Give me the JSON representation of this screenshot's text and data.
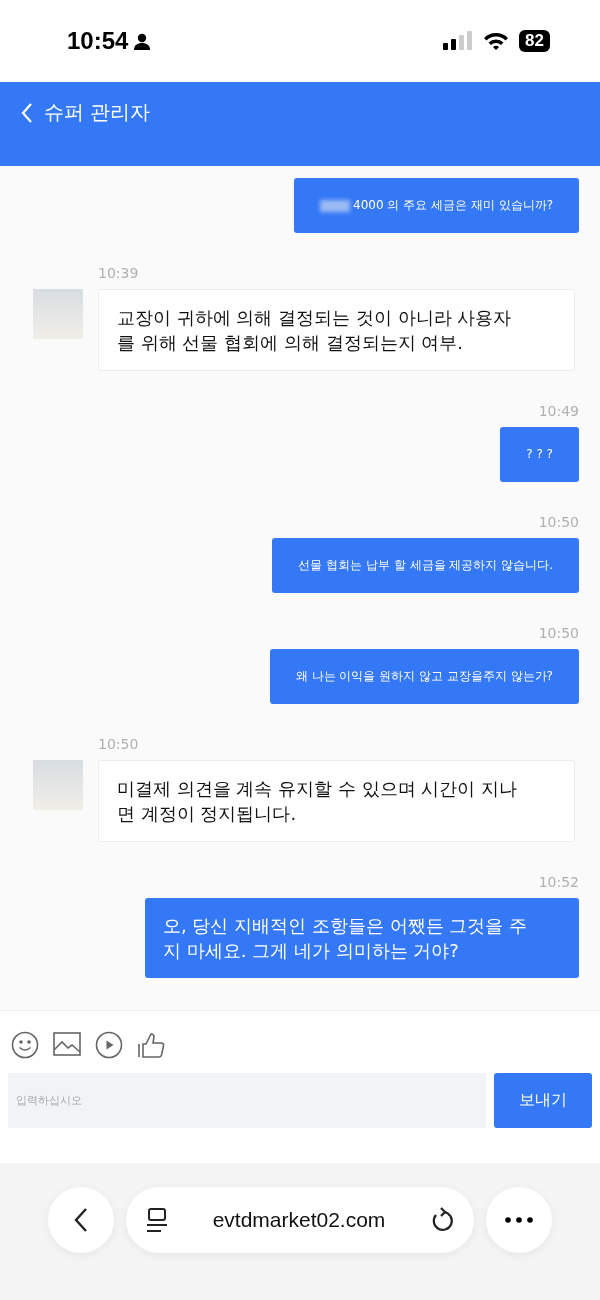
{
  "status_bar": {
    "time": "10:54",
    "battery": "82"
  },
  "header": {
    "title": "슈퍼 관리자"
  },
  "messages": [
    {
      "kind": "outgoing",
      "redacted": true,
      "text": "4000 의 주요 세금은 재미 있습니까?"
    },
    {
      "kind": "incoming",
      "time": "10:39",
      "text": "교장이 귀하에 의해 결정되는 것이 아니라 사용자를 위해 선물 협회에 의해 결정되는지 여부."
    },
    {
      "kind": "outgoing",
      "time": "10:49",
      "text": "? ? ?"
    },
    {
      "kind": "outgoing",
      "time": "10:50",
      "text": "선물 협회는 납부 할 세금을 제공하지 않습니다."
    },
    {
      "kind": "outgoing",
      "time": "10:50",
      "text": "왜 나는 이익을 원하지 않고 교장을주지 않는가?"
    },
    {
      "kind": "incoming",
      "time": "10:50",
      "text": "미결제 의견을 계속 유지할 수 있으며 시간이 지나면 계정이 정지됩니다."
    },
    {
      "kind": "outgoing-large",
      "time": "10:52",
      "text": "오, 당신 지배적인 조항들은 어쨌든 그것을 주지 마세요. 그게 네가 의미하는 거야?"
    }
  ],
  "composer": {
    "placeholder": "입력하십시오",
    "send": "보내기"
  },
  "browser": {
    "url": "evtdmarket02.com"
  }
}
